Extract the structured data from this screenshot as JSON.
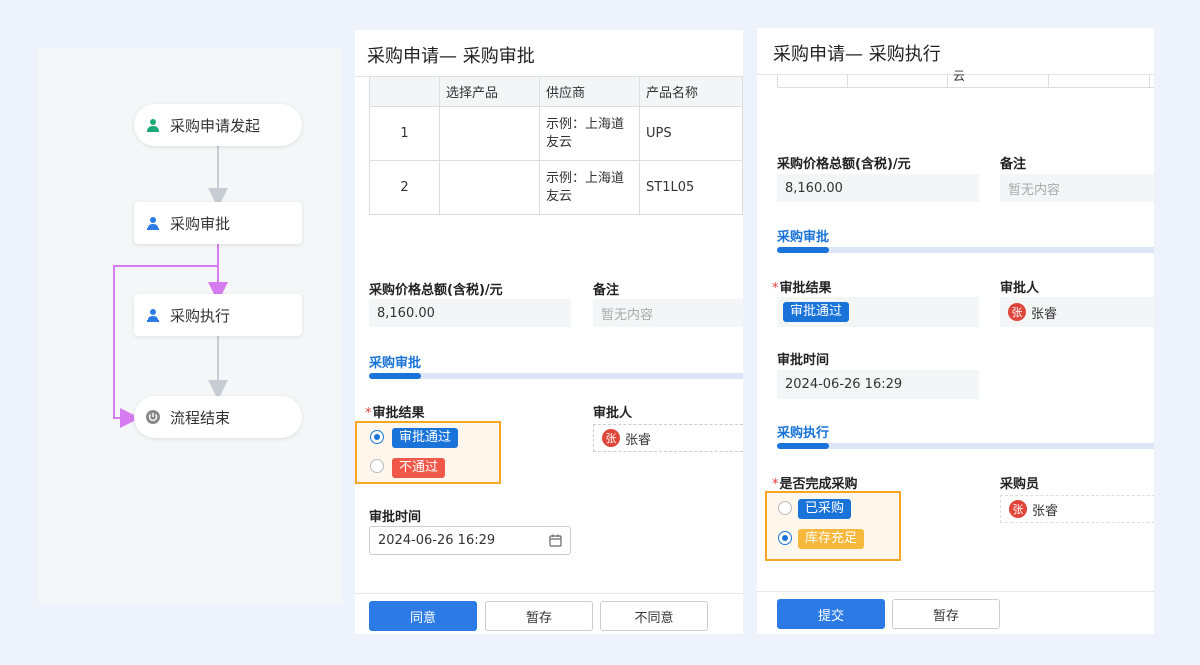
{
  "flow": {
    "nodes": [
      {
        "label": "采购申请发起",
        "icon": "user-icon"
      },
      {
        "label": "采购审批",
        "icon": "approver-icon"
      },
      {
        "label": "采购执行",
        "icon": "approver-icon"
      },
      {
        "label": "流程结束",
        "icon": "power-icon"
      }
    ],
    "colors": {
      "start_icon": "#19a974",
      "task_icon": "#2b7ae6",
      "end_icon": "#888888",
      "loop_line": "#d57cf0",
      "line": "#c8ccd3"
    }
  },
  "approval_form": {
    "title": "采购申请— 采购审批",
    "table": {
      "headers": [
        "",
        "选择产品",
        "供应商",
        "产品名称"
      ],
      "rows": [
        [
          "1",
          "",
          "示例：上海道友云",
          "UPS"
        ],
        [
          "2",
          "",
          "示例：上海道友云",
          "ST1L05"
        ]
      ]
    },
    "total_label": "采购价格总额(含税)/元",
    "total_value": "8,160.00",
    "remark_label": "备注",
    "remark_placeholder": "暂无内容",
    "section_title": "采购审批",
    "result_label": "审批结果",
    "result_options": [
      {
        "label": "审批通过",
        "selected": true
      },
      {
        "label": "不通过",
        "selected": false
      }
    ],
    "approver_label": "审批人",
    "approver_avatar": "张",
    "approver_name": "张睿",
    "time_label": "审批时间",
    "time_value": "2024-06-26 16:29",
    "buttons": {
      "agree": "同意",
      "save": "暂存",
      "disagree": "不同意"
    }
  },
  "execution_form": {
    "title": "采购申请— 采购执行",
    "partial_text": "云",
    "total_label": "采购价格总额(含税)/元",
    "total_value": "8,160.00",
    "remark_label": "备注",
    "remark_placeholder": "暂无内容",
    "approval_section": "采购审批",
    "result_label": "审批结果",
    "result_tag": "审批通过",
    "approver_label": "审批人",
    "approver_avatar": "张",
    "approver_name": "张睿",
    "time_label": "审批时间",
    "time_value": "2024-06-26 16:29",
    "execution_section": "采购执行",
    "done_label": "是否完成采购",
    "done_options": [
      {
        "label": "已采购",
        "selected": false
      },
      {
        "label": "库存充足",
        "selected": true
      }
    ],
    "buyer_label": "采购员",
    "buyer_avatar": "张",
    "buyer_name": "张睿",
    "buttons": {
      "submit": "提交",
      "save": "暂存"
    }
  }
}
